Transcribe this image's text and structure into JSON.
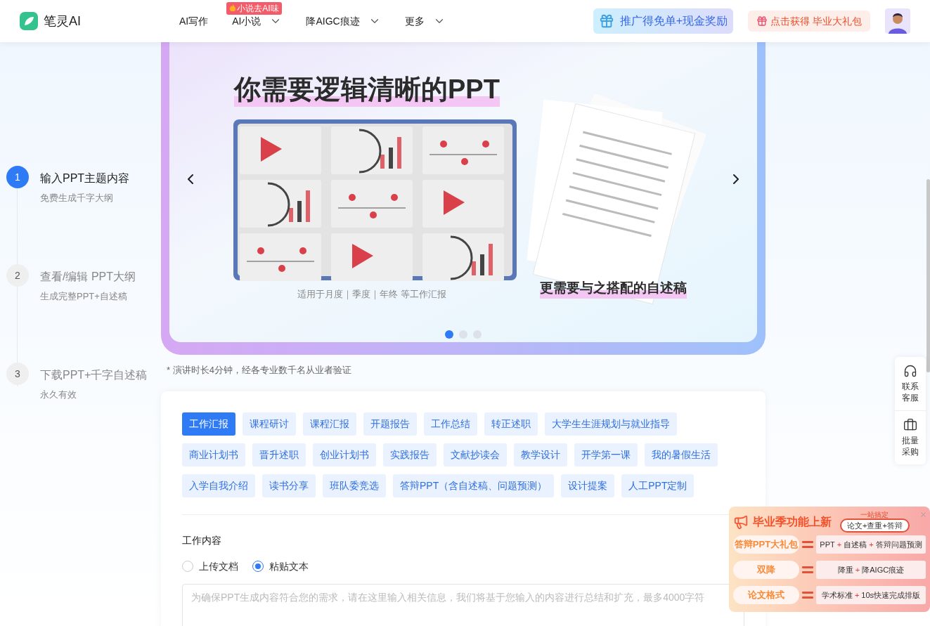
{
  "header": {
    "logo": "笔灵AI",
    "nav": [
      {
        "label": "AI写作",
        "dropdown": false
      },
      {
        "label": "AI小说",
        "dropdown": true,
        "badge": "小说去AI味"
      },
      {
        "label": "降AIGC痕迹",
        "dropdown": true
      },
      {
        "label": "更多",
        "dropdown": true
      }
    ],
    "promos": [
      {
        "kind": "referral",
        "text": "推广得免单+现金奖励"
      },
      {
        "kind": "gift",
        "text": "点击获得 毕业大礼包"
      }
    ]
  },
  "steps": [
    {
      "number": "1",
      "title": "输入PPT主题内容",
      "subtitle": "免费生成千字大纲",
      "selected": true
    },
    {
      "number": "2",
      "title": "查看/编辑 PPT大纲",
      "subtitle": "生成完整PPT+自述稿",
      "selected": false
    },
    {
      "number": "3",
      "title": "下载PPT+千字自述稿",
      "subtitle": "永久有效",
      "selected": false
    }
  ],
  "banner": {
    "headline": "你需要逻辑清晰的PPT",
    "caption": "适用于月度｜季度｜年终 等工作汇报",
    "doc_caption": "更需要与之搭配的自述稿",
    "dots": [
      {
        "selected": true
      },
      {
        "selected": false
      },
      {
        "selected": false
      }
    ]
  },
  "note": "* 演讲时长4分钟，经各专业数千名从业者验证",
  "tags": [
    {
      "label": "工作汇报",
      "selected": true
    },
    {
      "label": "课程研讨",
      "selected": false
    },
    {
      "label": "课程汇报",
      "selected": false
    },
    {
      "label": "开题报告",
      "selected": false
    },
    {
      "label": "工作总结",
      "selected": false
    },
    {
      "label": "转正述职",
      "selected": false
    },
    {
      "label": "大学生生涯规划与就业指导",
      "selected": false
    },
    {
      "label": "商业计划书",
      "selected": false
    },
    {
      "label": "晋升述职",
      "selected": false
    },
    {
      "label": "创业计划书",
      "selected": false
    },
    {
      "label": "实践报告",
      "selected": false
    },
    {
      "label": "文献抄读会",
      "selected": false
    },
    {
      "label": "教学设计",
      "selected": false
    },
    {
      "label": "开学第一课",
      "selected": false
    },
    {
      "label": "我的暑假生活",
      "selected": false
    },
    {
      "label": "入学自我介绍",
      "selected": false
    },
    {
      "label": "读书分享",
      "selected": false
    },
    {
      "label": "班队委竞选",
      "selected": false
    },
    {
      "label": "答辩PPT（含自述稿、问题预测）",
      "selected": false
    },
    {
      "label": "设计提案",
      "selected": false
    },
    {
      "label": "人工PPT定制",
      "selected": false
    }
  ],
  "form": {
    "label": "工作内容",
    "options": [
      {
        "label": "上传文档",
        "selected": false
      },
      {
        "label": "粘贴文本",
        "selected": true
      }
    ],
    "placeholder": "为确保PPT生成内容符合您的需求，请在这里输入相关信息，我们将基于您输入的内容进行总结和扩充，最多4000字符"
  },
  "side_tools": [
    {
      "kind": "support",
      "label": "联系客服"
    },
    {
      "kind": "bulk",
      "label": "批量采购"
    }
  ],
  "promo_card": {
    "title": "毕业季功能上新",
    "tagline_small": "一站搞定",
    "tagline": "论文+查重+答辩",
    "joiner": "+",
    "rows": [
      {
        "name": "答辩PPT大礼包",
        "parts": [
          "PPT",
          "自述稿",
          "答辩问题预测"
        ]
      },
      {
        "name": "双降",
        "parts": [
          "降重",
          "降AIGC痕迹"
        ]
      },
      {
        "name": "论文格式",
        "parts": [
          "学术标准",
          "10s快速完成排版"
        ]
      }
    ]
  }
}
